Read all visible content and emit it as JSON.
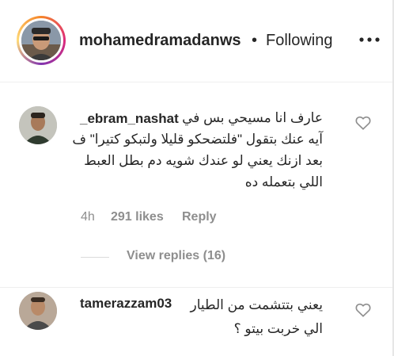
{
  "header": {
    "username": "mohamedramadanws",
    "dot": "•",
    "follow_status": "Following",
    "more_icon": "more-horizontal-icon"
  },
  "comments": [
    {
      "username": "_ebram_nashat",
      "text_lines": [
        "عارف انا مسيحي بس في",
        "آيه عنك بتقول \"فلتضحكو قليلا ولتبكو كتيرا\" ف",
        "بعد ازنك يعني لو عندك شويه دم بطل العبط",
        "اللي بتعمله ده"
      ],
      "time": "4h",
      "likes": "291 likes",
      "reply_label": "Reply",
      "view_replies": "View replies (16)",
      "heart_icon": "heart-outline-icon"
    },
    {
      "username": "tamerazzam03",
      "text_first": "يعني بتتشمت من الطيار",
      "text_lines": [
        "الي خربت بيتو ؟"
      ],
      "heart_icon": "heart-outline-icon"
    }
  ]
}
